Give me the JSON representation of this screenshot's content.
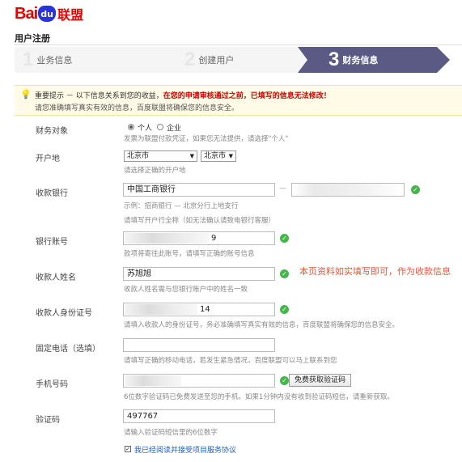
{
  "logo": {
    "bai": "Bai",
    "du": "du",
    "lianmeng": "联盟"
  },
  "page_title": "用户注册",
  "steps": [
    {
      "num": "1",
      "label": "业务信息"
    },
    {
      "num": "2",
      "label": "创建用户"
    },
    {
      "num": "3",
      "label": "财务信息"
    }
  ],
  "notice": {
    "prefix": "重要提示 － 以下信息关系到您的收益，",
    "bold": "在您的申请审核通过之前，已填写的信息无法修改！",
    "line2": "请您准确填写真实有效的信息，百度联盟将确保您的信息安全。"
  },
  "form": {
    "finance_target": {
      "label": "财务对象",
      "option_personal": "个人",
      "option_company": "企业",
      "hint": "发票为联盟付款凭证，如果您无法提供，请选择\"个人\""
    },
    "account_location": {
      "label": "开户地",
      "province": "北京市",
      "city": "北京市",
      "hint": "请选择正确的开户地"
    },
    "bank": {
      "label": "收款银行",
      "bank_name": "中国工商银行",
      "separator": "—",
      "hint1": "示例：招商银行 — 北京分行上地支行",
      "hint2": "请填写开户行全称（如无法确认请致电银行客服）"
    },
    "account_number": {
      "label": "银行账号",
      "value_tail": "9",
      "hint": "款项将寄往此账号，请填写正确的账号信息"
    },
    "payee_name": {
      "label": "收款人姓名",
      "value": "苏旭旭",
      "hint": "收款人姓名需与您银行账户中的姓名一致"
    },
    "id_number": {
      "label": "收款人身份证号",
      "value_tail": "14",
      "hint": "请填入收款人的身份证号，务必准确填写真实有效的信息，百度联盟将确保您的信息安全。"
    },
    "landline": {
      "label": "固定电话（选填）",
      "hint": "请填写正确的移动电话，若发生紧急情况，百度联盟可以马上联系到您"
    },
    "mobile": {
      "label": "手机号码",
      "button": "免费获取验证码",
      "hint": "6位数字验证码已免费发送至您的手机。如果1分钟内没有收到验证码短信，请重新获取。"
    },
    "code": {
      "label": "验证码",
      "value": "497767",
      "hint": "请输入验证码短信里的6位数字"
    },
    "agree": "我已经阅读并接受项目服务协议"
  },
  "side_note": "本页资料如实填写即可，作为收款信息",
  "colors": {
    "brand_red": "#e10601",
    "brand_blue": "#2932e1",
    "step_active": "#5a5a84",
    "ok_green": "#45b649",
    "note_red": "#e2563a"
  }
}
